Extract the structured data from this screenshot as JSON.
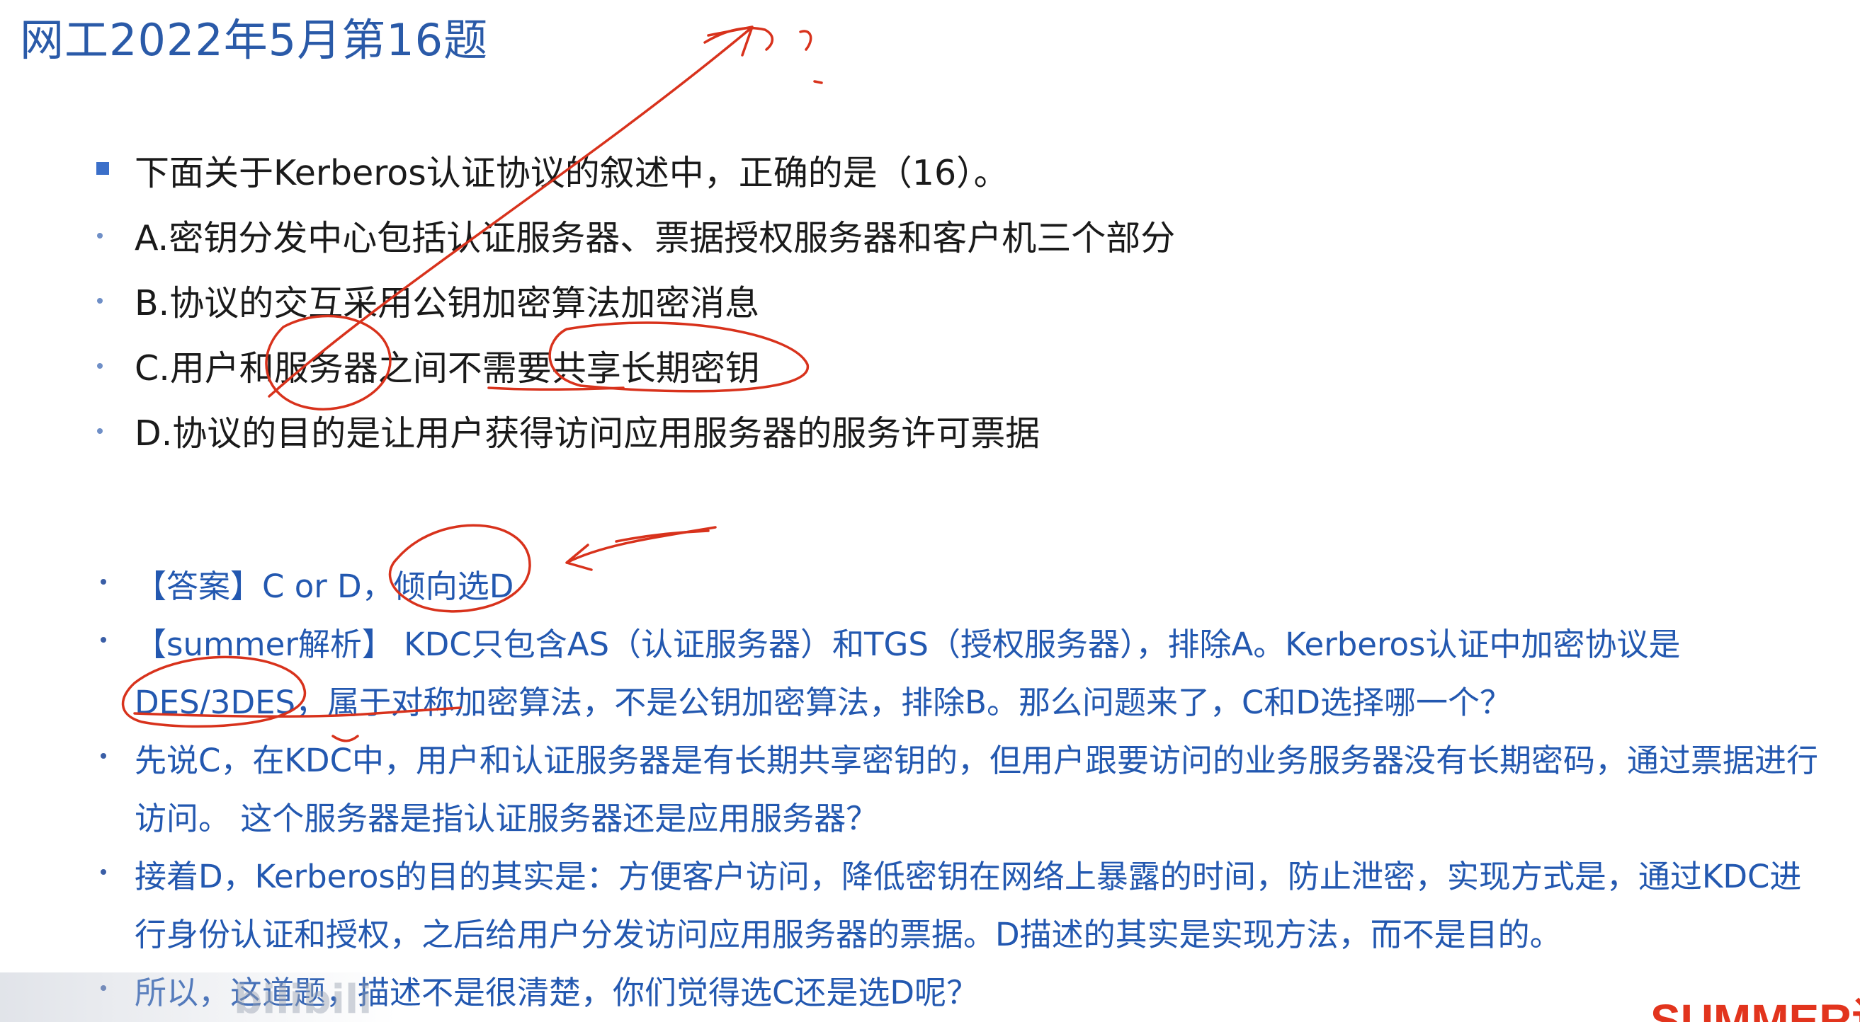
{
  "page": {
    "title": "网工2022年5月第16题"
  },
  "question": {
    "stem": "下面关于Kerberos认证协议的叙述中，正确的是（16）。",
    "options": [
      "A.密钥分发中心包括认证服务器、票据授权服务器和客户机三个部分",
      "B.协议的交互采用公钥加密算法加密消息",
      "C.用户和服务器之间不需要共享长期密钥",
      "D.协议的目的是让用户获得访问应用服务器的服务许可票据"
    ]
  },
  "explanation": {
    "lines": [
      "【答案】C or D，倾向选D",
      "【summer解析】 KDC只包含AS（认证服务器）和TGS（授权服务器），排除A。Kerberos认证中加密协议是",
      "DES/3DES，属于对称加密算法，不是公钥加密算法，排除B。那么问题来了，C和D选择哪一个？",
      "先说C，在KDC中，用户和认证服务器是有长期共享密钥的，但用户跟要访问的业务服务器没有长期密码，通过票据进行",
      "访问。 这个服务器是指认证服务器还是应用服务器？",
      "接着D，Kerberos的目的其实是：方便客户访问，降低密钥在网络上暴露的时间，防止泄密，实现方式是，通过KDC进",
      "行身份认证和授权，之后给用户分发访问应用服务器的票据。D描述的其实是实现方法，而不是目的。",
      "所以，这道题，描述不是很清楚，你们觉得选C还是选D呢？"
    ]
  },
  "branding": {
    "logo_text": "SUMMER课堂",
    "watermark_text": "bilibili"
  },
  "colors": {
    "title": "#2a5aa8",
    "question_text": "#1a1a1a",
    "explanation_text": "#2358b0",
    "annotation_ink": "#d8321c",
    "logo": "#e2341d"
  }
}
